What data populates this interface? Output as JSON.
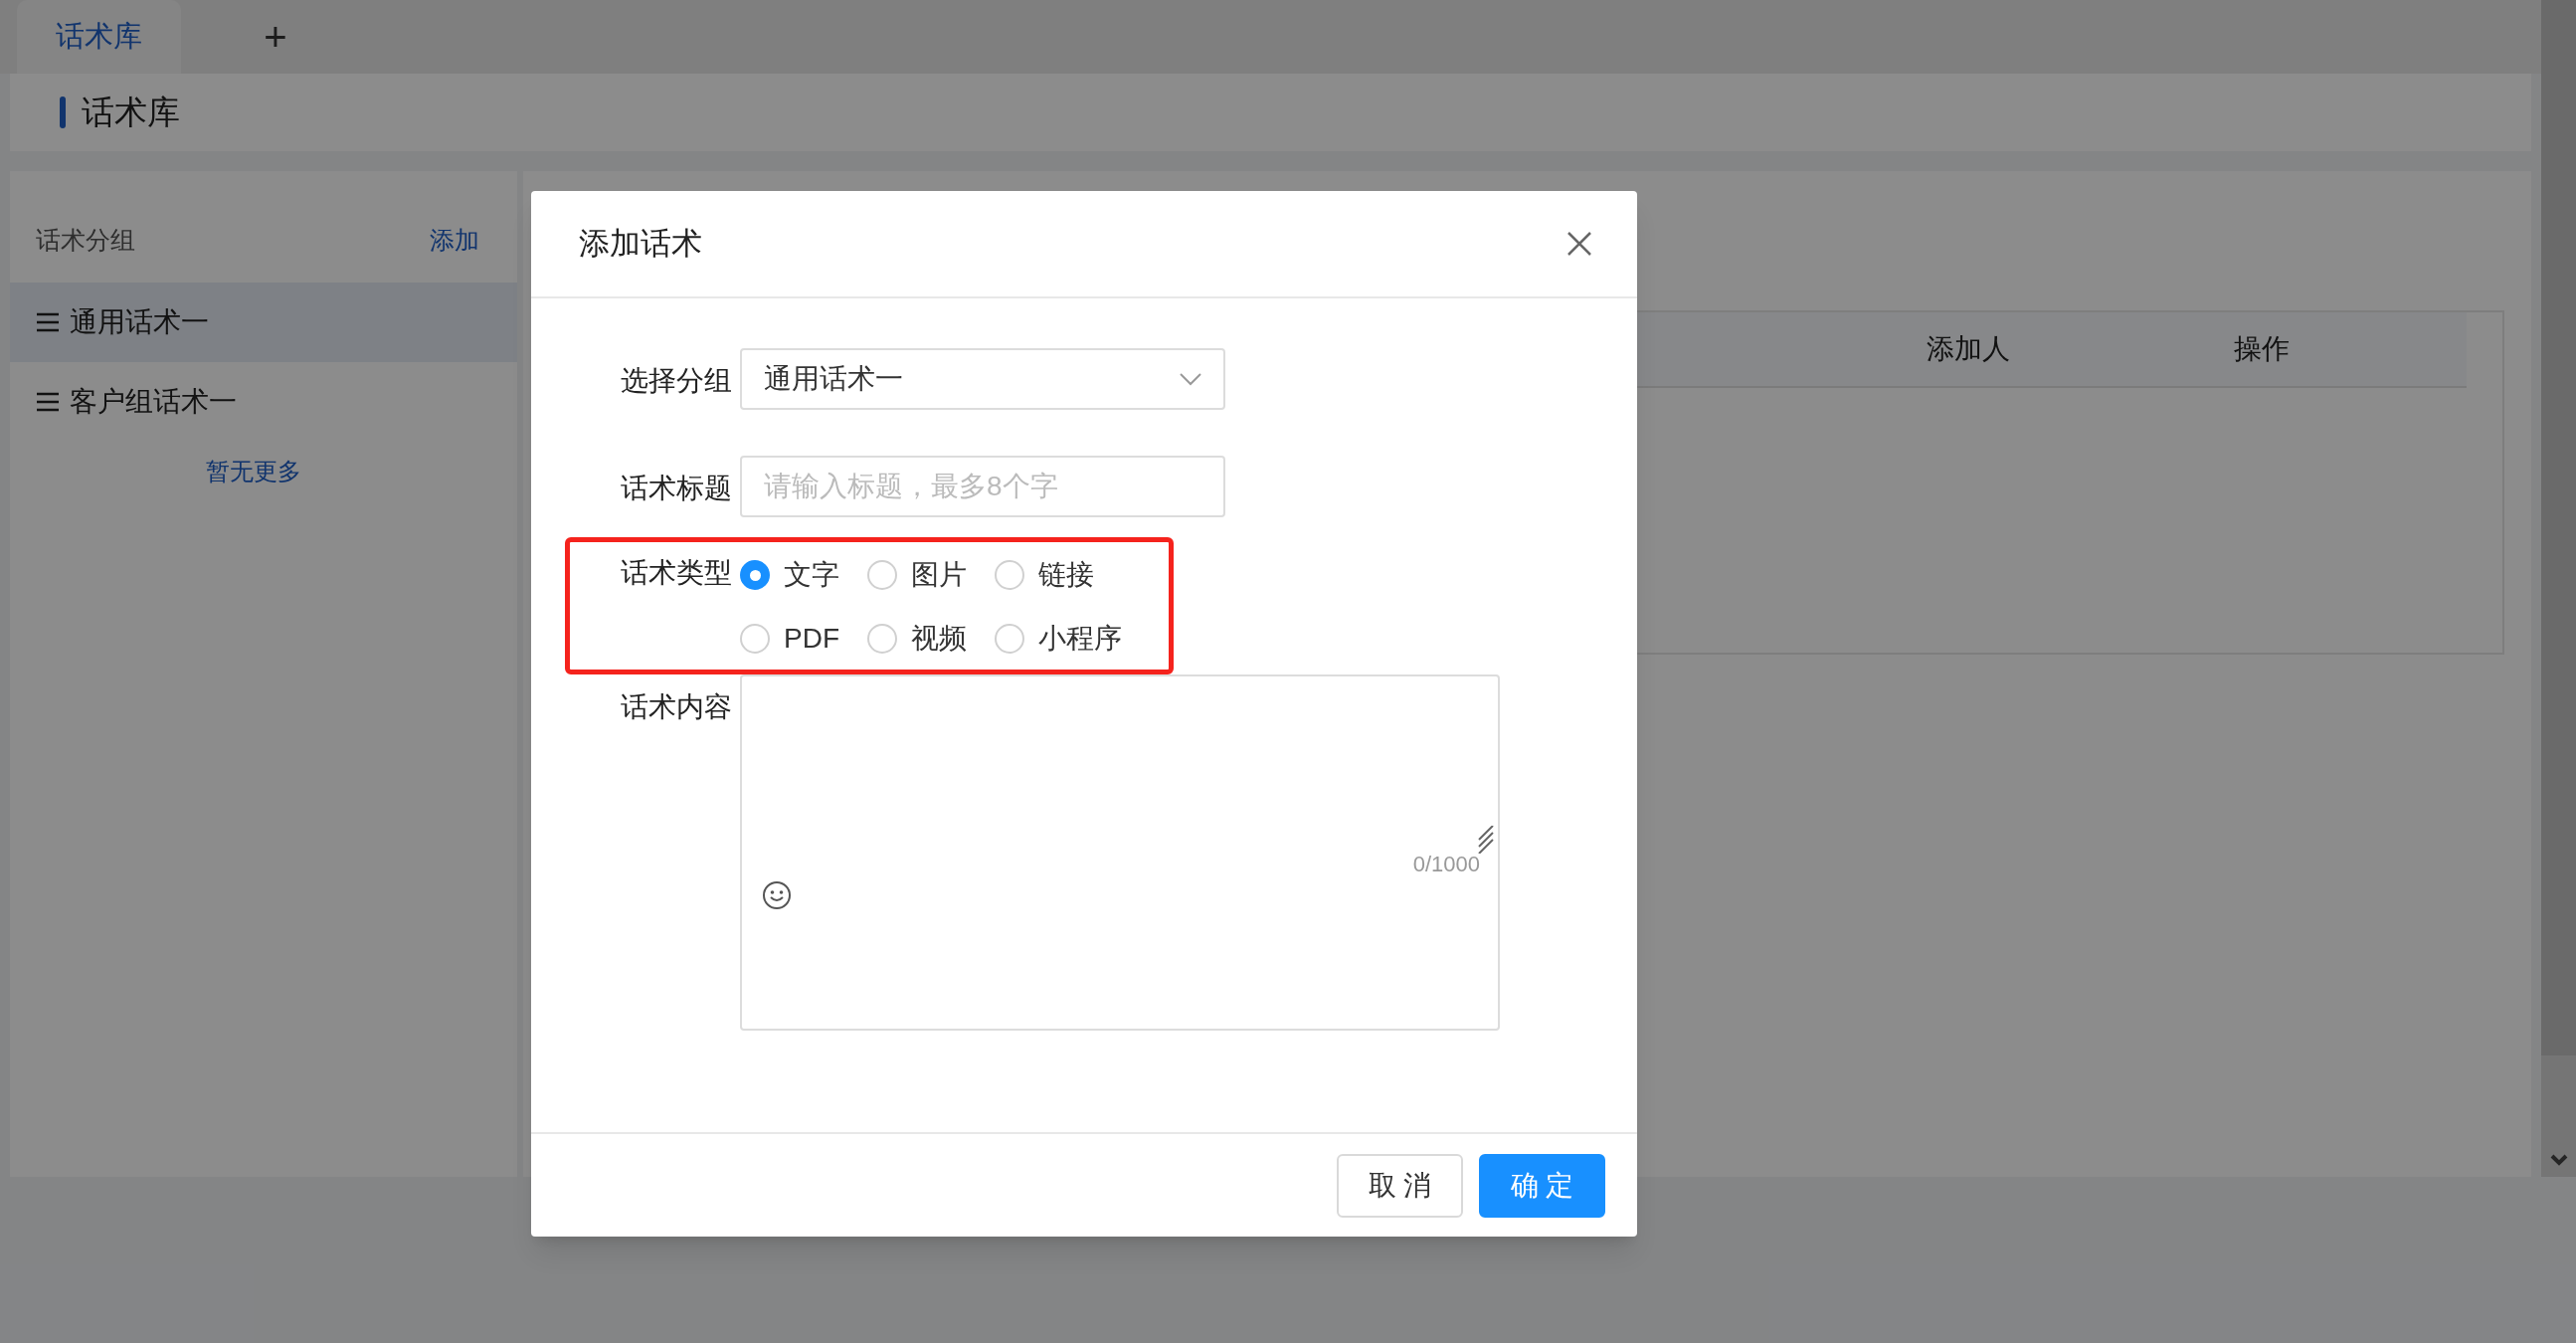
{
  "tabs": [
    {
      "label": "话术库",
      "selected": true
    }
  ],
  "add_tab": "+",
  "page_title": "话术库",
  "sidebar": {
    "header": "话术分组",
    "add_link": "添加",
    "items": [
      {
        "label": "通用话术一",
        "selected": true
      },
      {
        "label": "客户组话术一",
        "selected": false
      }
    ],
    "footer": "暂无更多"
  },
  "table": {
    "columns": [
      "添加人",
      "操作"
    ]
  },
  "dialog": {
    "title": "添加话术",
    "fields": [
      {
        "kind": "select",
        "label": "选择分组",
        "value": "通用话术一"
      },
      {
        "kind": "input",
        "label": "话术标题",
        "placeholder": "请输入标题，最多8个字"
      },
      {
        "kind": "radio",
        "label": "话术类型",
        "highlighted": true,
        "options": [
          {
            "label": "文字",
            "selected": true
          },
          {
            "label": "图片",
            "selected": false
          },
          {
            "label": "链接",
            "selected": false
          },
          {
            "label": "PDF",
            "selected": false
          },
          {
            "label": "视频",
            "selected": false
          },
          {
            "label": "小程序",
            "selected": false
          }
        ]
      },
      {
        "kind": "textarea",
        "label": "话术内容",
        "counter": "0/1000"
      }
    ],
    "buttons": [
      {
        "label": "取 消",
        "kind": "default"
      },
      {
        "label": "确 定",
        "kind": "primary"
      }
    ]
  }
}
